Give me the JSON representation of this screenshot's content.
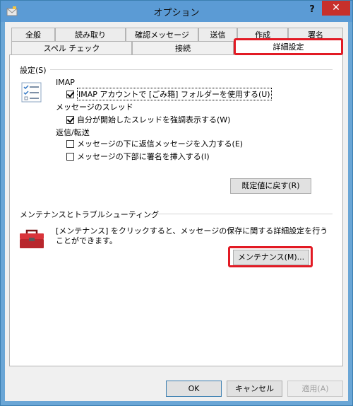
{
  "window": {
    "title": "オプション",
    "help_label": "?",
    "close_label": "✕"
  },
  "tabs": {
    "back_row": [
      "全般",
      "読み取り",
      "確認メッセージ",
      "送信",
      "作成",
      "署名"
    ],
    "front_row": [
      "スペル チェック",
      "接続",
      "詳細設定"
    ],
    "active": "詳細設定"
  },
  "settings": {
    "section_label": "設定(S)",
    "imap_label": "IMAP",
    "imap_option": "IMAP アカウントで [ごみ箱] フォルダーを使用する(U)",
    "thread_label": "メッセージのスレッド",
    "thread_option": "自分が開始したスレッドを強調表示する(W)",
    "reply_label": "返信/転送",
    "reply_option1": "メッセージの下に返信メッセージを入力する(E)",
    "reply_option2": "メッセージの下部に署名を挿入する(I)",
    "restore_button": "既定値に戻す(R)"
  },
  "maintenance": {
    "section_label": "メンテナンスとトラブルシューティング",
    "description": "[メンテナンス] をクリックすると、メッセージの保存に関する詳細設定を行うことができます。",
    "button": "メンテナンス(M)..."
  },
  "footer": {
    "ok": "OK",
    "cancel": "キャンセル",
    "apply": "適用(A)"
  },
  "colors": {
    "titlebar": "#5b9bd5",
    "close": "#c7302b",
    "highlight": "#e21a24"
  }
}
